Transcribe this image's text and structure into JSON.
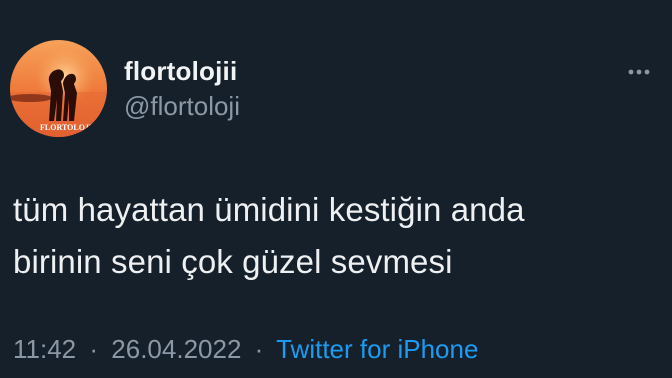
{
  "author": {
    "display_name": "flortolojii",
    "handle": "@flortoloji",
    "avatar_caption": "FLORTOLOJI"
  },
  "tweet": {
    "lines": [
      "tüm hayattan ümidini kestiğin anda",
      "birinin seni çok güzel sevmesi"
    ],
    "time": "11:42",
    "date": "26.04.2022",
    "separator": "·",
    "source": "Twitter for iPhone"
  },
  "icons": {
    "more": "more-horizontal-icon"
  },
  "colors": {
    "background": "#15202b",
    "primary_text": "#e7e9ea",
    "secondary_text": "#8b98a5",
    "link": "#1d9bf0"
  }
}
